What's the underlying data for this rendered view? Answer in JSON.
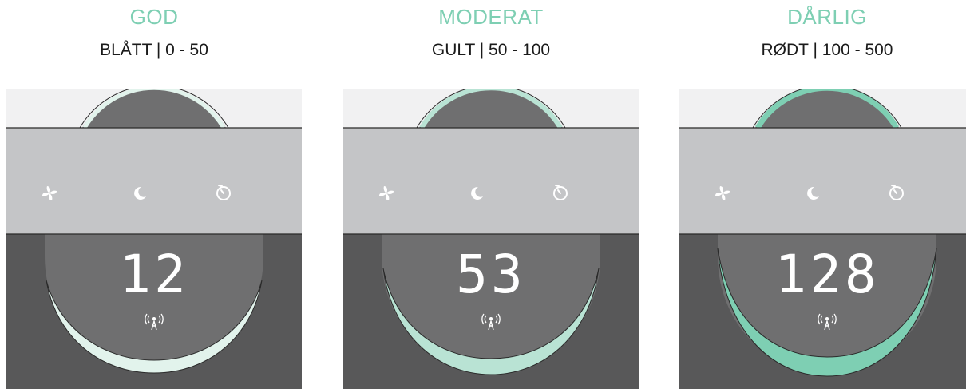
{
  "panels": [
    {
      "title": "GOD",
      "subtitle": "BLÅTT | 0 - 50",
      "reading": "12",
      "ring_fill": 0.12
    },
    {
      "title": "MODERAT",
      "subtitle": "GULT | 50 - 100",
      "reading": "53",
      "ring_fill": 0.55
    },
    {
      "title": "DÅRLIG",
      "subtitle": "RØDT | 100 - 500",
      "reading": "128",
      "ring_fill": 1.0
    }
  ],
  "icons": [
    "fan-icon",
    "moon-icon",
    "timer-icon",
    "wifi-antenna-icon"
  ],
  "colors": {
    "accent": "#7ecfb3",
    "ring_light": "#e2f3ec",
    "ring_mid": "#b9e3d4",
    "ring_strong": "#7ecfb3",
    "control_bar": "#c4c5c7",
    "top_band": "#f1f1f2",
    "body_dark": "#585859",
    "dial": "#6f6f70",
    "text_dark": "#1a1a1a"
  }
}
